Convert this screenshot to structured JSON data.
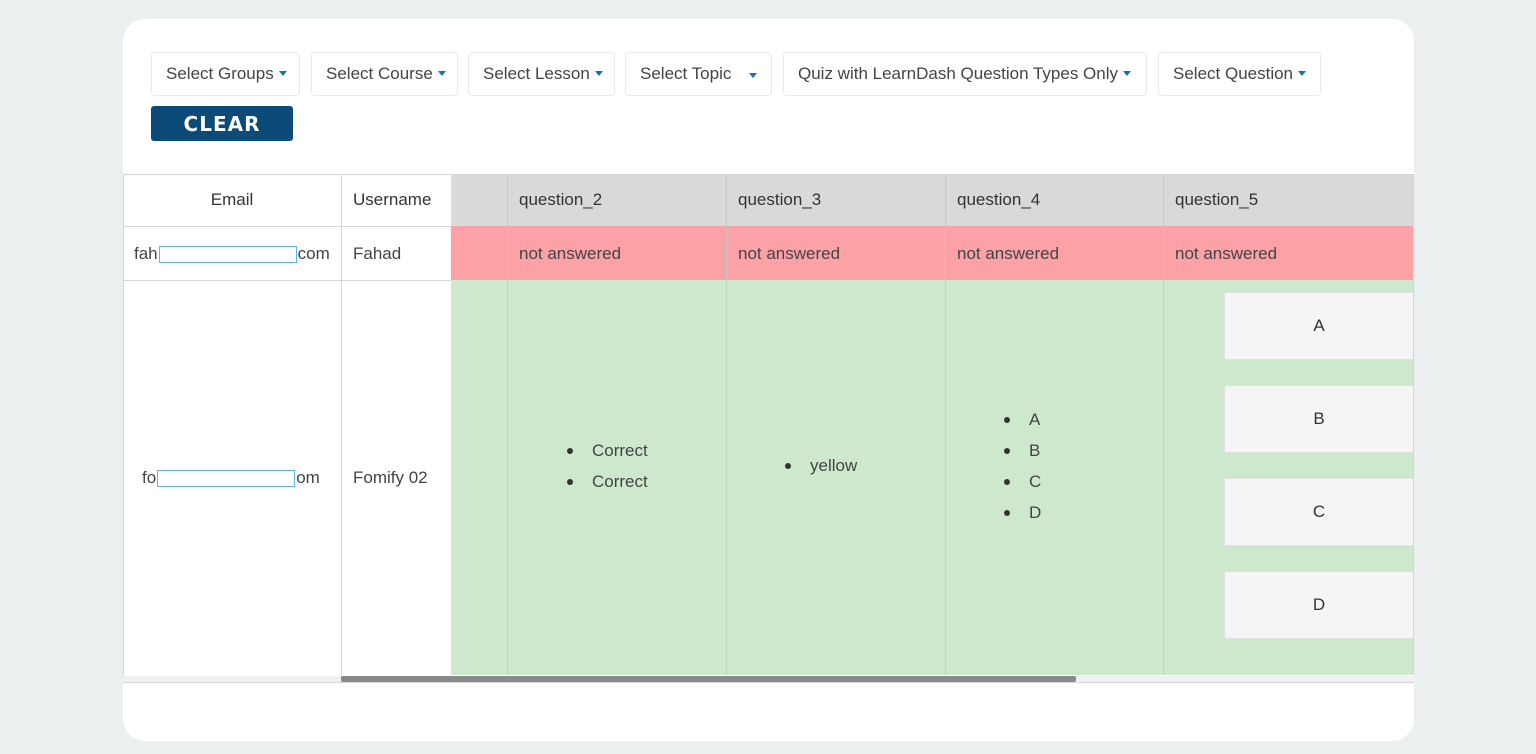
{
  "filters": [
    {
      "label": "Select Groups"
    },
    {
      "label": "Select Course"
    },
    {
      "label": "Select Lesson"
    },
    {
      "label": "Select Topic"
    },
    {
      "label": "Quiz with LearnDash Question Types Only"
    },
    {
      "label": "Select Question"
    }
  ],
  "clear_label": "CLEAR",
  "table": {
    "headers": {
      "email": "Email",
      "username": "Username",
      "q2": "question_2",
      "q3": "question_3",
      "q4": "question_4",
      "q5": "question_5"
    },
    "rows": [
      {
        "email_prefix": "fah",
        "email_suffix": "com",
        "username": "Fahad",
        "q2": "not answered",
        "q3": "not answered",
        "q4": "not answered",
        "q5": "not answered"
      },
      {
        "email_prefix": "fo",
        "email_suffix": "om",
        "username": "Fomify 02",
        "q2": [
          "Correct",
          "Correct"
        ],
        "q3": [
          "yellow"
        ],
        "q4": [
          "A",
          "B",
          "C",
          "D"
        ],
        "q5_choices": [
          "A",
          "B",
          "C",
          "D"
        ]
      }
    ]
  },
  "colors": {
    "accent": "#0c4a78",
    "caret": "#1a70a8",
    "not_answered_bg": "#fca1a6",
    "answered_bg": "#cee8cd",
    "header_bg": "#d9d9d9"
  }
}
